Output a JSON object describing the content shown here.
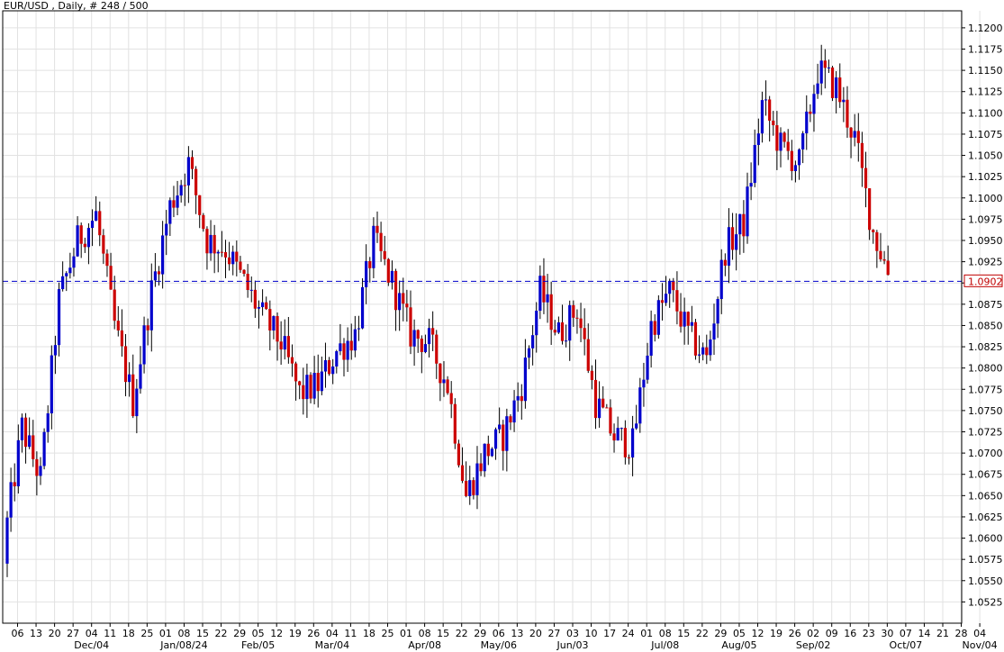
{
  "chart_data": {
    "type": "candlestick",
    "title": "EUR/USD , Daily, # 248 / 500",
    "current_price": 1.0902,
    "ylim": [
      1.05,
      1.122
    ],
    "y_ticks": [
      "1.0525",
      "1.0550",
      "1.0575",
      "1.0600",
      "1.0625",
      "1.0650",
      "1.0675",
      "1.0700",
      "1.0725",
      "1.0750",
      "1.0775",
      "1.0800",
      "1.0825",
      "1.0850",
      "1.0875",
      "1.0900",
      "1.0925",
      "1.0950",
      "1.0975",
      "1.1000",
      "1.1025",
      "1.1050",
      "1.1075",
      "1.1100",
      "1.1125",
      "1.1150",
      "1.1175",
      "1.1200"
    ],
    "x_day_labels": [
      "06",
      "13",
      "20",
      "27",
      "04",
      "11",
      "18",
      "25",
      "01",
      "08",
      "15",
      "22",
      "29",
      "05",
      "12",
      "19",
      "26",
      "04",
      "11",
      "18",
      "25",
      "01",
      "08",
      "15",
      "22",
      "29",
      "06",
      "13",
      "20",
      "27",
      "03",
      "10",
      "17",
      "24",
      "01",
      "08",
      "15",
      "22",
      "29",
      "05",
      "12",
      "19",
      "26",
      "02",
      "09",
      "16",
      "23",
      "30",
      "07",
      "14",
      "21",
      "28",
      "04"
    ],
    "x_month_labels": [
      {
        "label": "Dec/04",
        "week": 4
      },
      {
        "label": "Jan/08/24",
        "week": 9
      },
      {
        "label": "Feb/05",
        "week": 13
      },
      {
        "label": "Mar/04",
        "week": 17
      },
      {
        "label": "Apr/08",
        "week": 22
      },
      {
        "label": "May/06",
        "week": 26
      },
      {
        "label": "Jun/03",
        "week": 30
      },
      {
        "label": "Jul/08",
        "week": 35
      },
      {
        "label": "Aug/05",
        "week": 39
      },
      {
        "label": "Sep/02",
        "week": 43
      },
      {
        "label": "Oct/07",
        "week": 48
      },
      {
        "label": "Nov/04",
        "week": 52
      }
    ],
    "bull_color": "#0000cc",
    "bear_color": "#cc0000",
    "wick_color": "#000000",
    "current_line_color": "#0000cc",
    "grid": true,
    "weekly_closes": [
      1.059,
      1.073,
      1.067,
      1.088,
      1.095,
      1.098,
      1.085,
      1.076,
      1.089,
      1.099,
      1.104,
      1.095,
      1.094,
      1.09,
      1.086,
      1.083,
      1.077,
      1.078,
      1.082,
      1.084,
      1.095,
      1.09,
      1.084,
      1.083,
      1.078,
      1.065,
      1.07,
      1.072,
      1.078,
      1.089,
      1.084,
      1.087,
      1.076,
      1.072,
      1.071,
      1.085,
      1.089,
      1.084,
      1.081,
      1.094,
      1.097,
      1.111,
      1.106,
      1.104,
      1.115,
      1.113,
      1.107,
      1.096,
      1.0902
    ]
  }
}
